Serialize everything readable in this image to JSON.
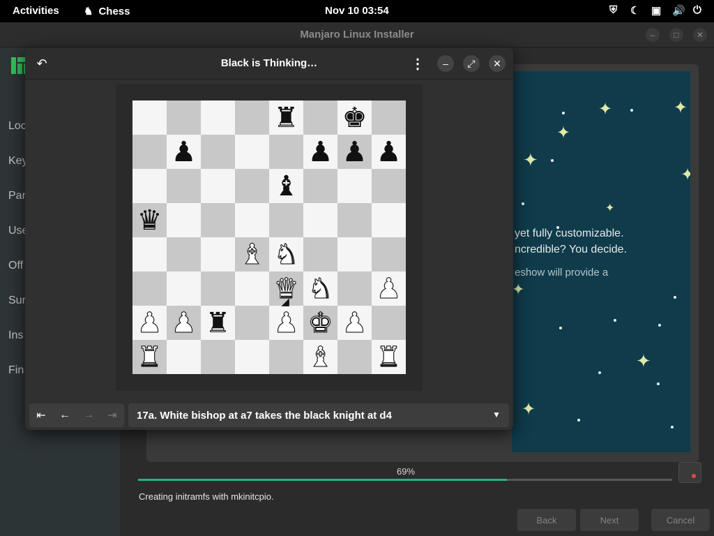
{
  "topbar": {
    "activities": "Activities",
    "app_name": "Chess",
    "clock": "Nov 10  03:54",
    "icons": [
      "shield-icon",
      "night-mode-icon",
      "screen-icon",
      "volume-icon",
      "power-icon"
    ]
  },
  "installer": {
    "title": "Manjaro Linux Installer",
    "steps": [
      "Loc",
      "Key",
      "Par",
      "Use",
      "Off",
      "Sur",
      "Ins",
      "Fin"
    ],
    "slide_lines": [
      "yet fully customizable.",
      "ncredible? You decide.",
      "eshow will provide a"
    ],
    "progress": {
      "percent_label": "69%",
      "value": 69
    },
    "status": "Creating initramfs with mkinitcpio.",
    "buttons": {
      "back": "Back",
      "next": "Next",
      "cancel": "Cancel"
    },
    "colors": {
      "accent": "#24b28a",
      "slide_bg": "#0f3b4b"
    }
  },
  "chess": {
    "title": "Black is Thinking…",
    "history_text": "17a. White bishop at a7 takes the black knight at d4",
    "board": [
      [
        "",
        "",
        "",
        "",
        "r",
        "",
        "k",
        ""
      ],
      [
        "",
        "p",
        "",
        "",
        "",
        "p",
        "p",
        "p"
      ],
      [
        "",
        "",
        "",
        "",
        "b",
        "",
        "",
        ""
      ],
      [
        "q",
        "",
        "",
        "",
        "",
        "",
        "",
        ""
      ],
      [
        "",
        "",
        "",
        "B",
        "N",
        "",
        "",
        ""
      ],
      [
        "",
        "",
        "",
        "",
        "Q",
        "N",
        "",
        "P"
      ],
      [
        "P",
        "P",
        "r",
        "",
        "P",
        "K",
        "P",
        ""
      ],
      [
        "R",
        "",
        "",
        "",
        "",
        "B",
        "",
        "R"
      ]
    ]
  }
}
